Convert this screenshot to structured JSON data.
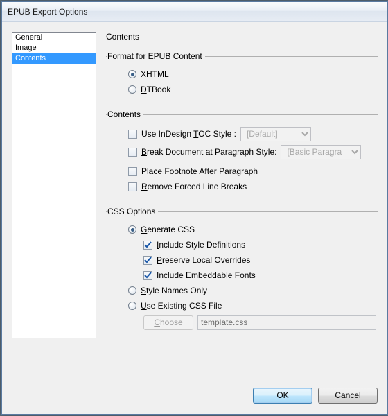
{
  "window": {
    "title": "EPUB Export Options"
  },
  "sidebar": {
    "items": [
      {
        "label": "General",
        "selected": false
      },
      {
        "label": "Image",
        "selected": false
      },
      {
        "label": "Contents",
        "selected": true
      }
    ]
  },
  "page": {
    "heading": "Contents",
    "format_group": {
      "legend": "Format for EPUB Content",
      "options": [
        {
          "label": "XHTML",
          "checked": true,
          "hotkey_index": 0
        },
        {
          "label": "DTBook",
          "checked": false,
          "hotkey_index": 0
        }
      ]
    },
    "contents_group": {
      "legend": "Contents",
      "toc": {
        "label_pre": "Use InDesign ",
        "label_hot": "T",
        "label_post": "OC Style :",
        "checked": false,
        "dropdown_value": "[Default]",
        "dropdown_enabled": false
      },
      "break": {
        "label_hot": "B",
        "label_rest": "reak Document at Paragraph Style:",
        "checked": false,
        "dropdown_value": "[Basic Paragra",
        "dropdown_enabled": false
      },
      "footnote": {
        "label": "Place Footnote After Paragraph",
        "checked": false
      },
      "remove": {
        "label_hot": "R",
        "label_rest": "emove Forced Line Breaks",
        "checked": false
      }
    },
    "css_group": {
      "legend": "CSS Options",
      "mode": [
        {
          "label_hot": "G",
          "label_rest": "enerate CSS",
          "checked": true
        },
        {
          "label_hot": "S",
          "label_rest": "tyle Names Only",
          "checked": false
        },
        {
          "label_hot": "U",
          "label_rest": "se Existing CSS File",
          "checked": false
        }
      ],
      "gen_opts": [
        {
          "label_hot": "I",
          "label_rest": "nclude Style Definitions",
          "checked": true
        },
        {
          "label_hot": "P",
          "label_rest": "reserve Local Overrides",
          "checked": true
        },
        {
          "label_pre": "Include ",
          "label_hot": "E",
          "label_post": "mbeddable Fonts",
          "checked": true
        }
      ],
      "existing": {
        "choose_label": "Choose",
        "choose_hot": "C",
        "choose_rest": "hoose",
        "choose_enabled": false,
        "path_value": "template.css",
        "path_enabled": false
      }
    }
  },
  "footer": {
    "ok": "OK",
    "cancel": "Cancel"
  }
}
